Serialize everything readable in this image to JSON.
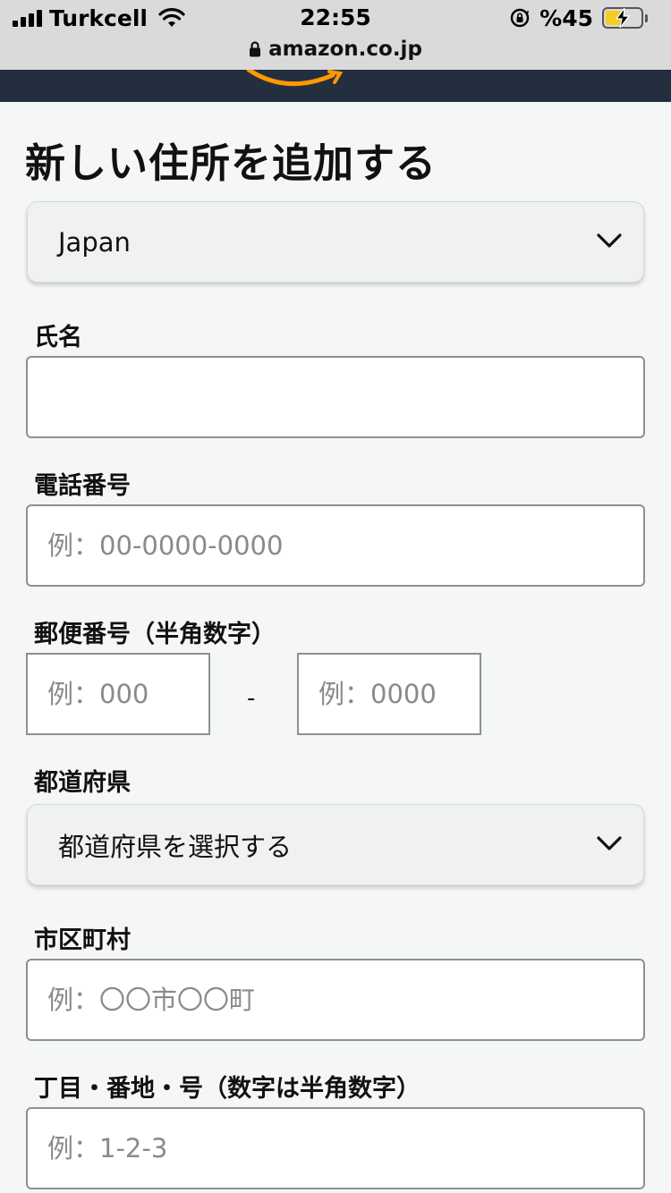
{
  "status_bar": {
    "carrier": "Turkcell",
    "time": "22:55",
    "battery_text": "%45",
    "battery_level": 0.45,
    "icons": [
      "signal-icon",
      "wifi-icon",
      "rotation-lock-icon",
      "battery-icon",
      "charging-bolt-icon"
    ]
  },
  "browser": {
    "url": "amazon.co.jp",
    "icons": [
      "lock-icon"
    ]
  },
  "form": {
    "title": "新しい住所を追加する",
    "country": {
      "selected": "Japan"
    },
    "name": {
      "label": "氏名",
      "value": "",
      "placeholder": ""
    },
    "phone": {
      "label": "電話番号",
      "placeholder": "例：00-0000-0000"
    },
    "postal": {
      "label": "郵便番号（半角数字）",
      "placeholder_first": "例：000",
      "separator": "-",
      "placeholder_second": "例：0000"
    },
    "prefecture": {
      "label": "都道府県",
      "selected": "都道府県を選択する"
    },
    "city": {
      "label": "市区町村",
      "placeholder": "例：〇〇市〇〇町"
    },
    "address": {
      "label": "丁目・番地・号（数字は半角数字）",
      "placeholder": "例：1-2-3"
    }
  },
  "colors": {
    "header_bg": "#232f3e",
    "logo_smile": "#ff9900",
    "status_bar_bg": "#dadada",
    "page_bg": "#f5f6f6",
    "battery_fill": "#f7cc25"
  }
}
